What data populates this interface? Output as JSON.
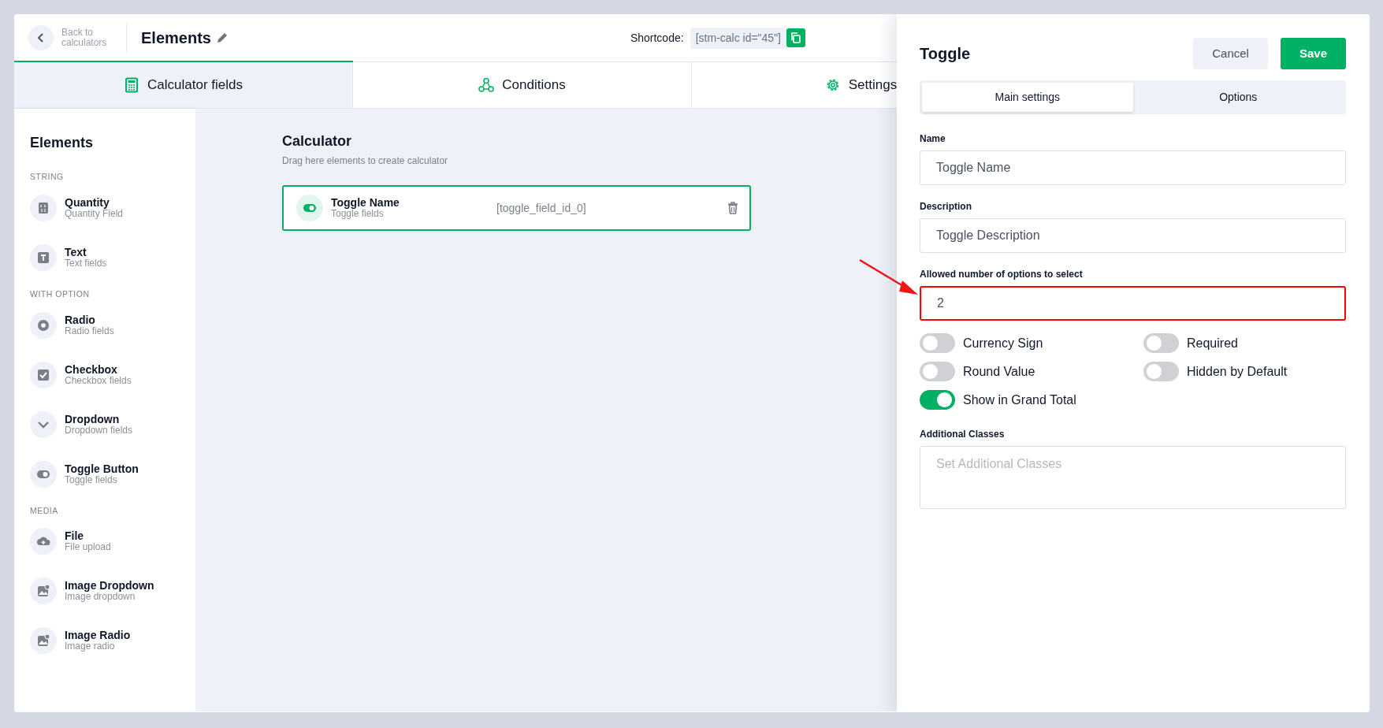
{
  "header": {
    "back_label": "Back to calculators",
    "title": "Elements",
    "shortcode_label": "Shortcode:",
    "shortcode": "[stm-calc id=\"45\"]"
  },
  "tabs": [
    {
      "kind": "calculator",
      "label": "Calculator fields",
      "selected": true
    },
    {
      "kind": "conditions",
      "label": "Conditions",
      "selected": false
    },
    {
      "kind": "settings",
      "label": "Settings",
      "selected": false
    }
  ],
  "sidebar": {
    "title": "Elements",
    "groups": [
      {
        "label": "STRING",
        "items": [
          {
            "kind": "quantity",
            "name": "Quantity",
            "description": "Quantity Field"
          },
          {
            "kind": "text",
            "name": "Text",
            "description": "Text fields"
          }
        ]
      },
      {
        "label": "WITH OPTION",
        "items": [
          {
            "kind": "radio",
            "name": "Radio",
            "description": "Radio fields"
          },
          {
            "kind": "checkbox",
            "name": "Checkbox",
            "description": "Checkbox fields"
          },
          {
            "kind": "dropdown",
            "name": "Dropdown",
            "description": "Dropdown fields"
          },
          {
            "kind": "toggle",
            "name": "Toggle Button",
            "description": "Toggle fields"
          }
        ]
      },
      {
        "label": "MEDIA",
        "items": [
          {
            "kind": "file",
            "name": "File",
            "description": "File upload"
          },
          {
            "kind": "image",
            "name": "Image Dropdown",
            "description": "Image dropdown"
          },
          {
            "kind": "image",
            "name": "Image Radio",
            "description": "Image radio"
          }
        ]
      }
    ]
  },
  "canvas": {
    "title": "Calculator",
    "subtitle": "Drag here elements to create calculator",
    "fields": [
      {
        "kind": "toggle",
        "name": "Toggle Name",
        "description": "Toggle fields",
        "field_id": "[toggle_field_id_0]",
        "selected": true
      }
    ]
  },
  "panel": {
    "title": "Toggle",
    "buttons": [
      {
        "kind": "secondary",
        "label": "Cancel"
      },
      {
        "kind": "primary",
        "label": "Save"
      }
    ],
    "tabs": [
      {
        "label": "Main settings",
        "selected": true
      },
      {
        "label": "Options",
        "selected": false
      }
    ],
    "fields": [
      {
        "label": "Name",
        "value": "Toggle Name",
        "highlighted": false
      },
      {
        "label": "Description",
        "value": "Toggle Description",
        "highlighted": false
      },
      {
        "label": "Allowed number of options to select",
        "value": "2",
        "highlighted": true
      }
    ],
    "switches": [
      {
        "label": "Currency Sign",
        "on": false
      },
      {
        "label": "Required",
        "on": false
      },
      {
        "label": "Round Value",
        "on": false
      },
      {
        "label": "Hidden by Default",
        "on": false
      },
      {
        "label": "Show in Grand Total",
        "on": true
      }
    ],
    "classes_field": {
      "label": "Additional Classes",
      "placeholder": "Set Additional Classes"
    }
  }
}
